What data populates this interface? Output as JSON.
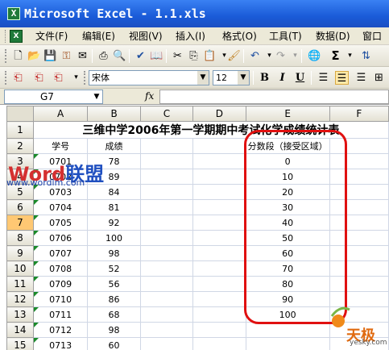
{
  "window": {
    "title": "Microsoft Excel - 1.1.xls",
    "app_icon_letter": "X"
  },
  "menu": [
    "文件(F)",
    "编辑(E)",
    "视图(V)",
    "插入(I)",
    "格式(O)",
    "工具(T)",
    "数据(D)",
    "窗口"
  ],
  "toolbar": {
    "font_name": "宋体",
    "font_size": "12",
    "bold": "B",
    "italic": "I",
    "underline": "U",
    "sigma": "Σ"
  },
  "formula_bar": {
    "name_box": "G7",
    "fx_label": "fx",
    "formula": ""
  },
  "sheet": {
    "columns": [
      "A",
      "B",
      "C",
      "D",
      "E",
      "F"
    ],
    "rows": [
      {
        "num": "1",
        "a": "",
        "b": "",
        "e": ""
      },
      {
        "num": "2",
        "a": "学号",
        "b": "成绩",
        "e": "分数段（接受区域）"
      },
      {
        "num": "3",
        "a": "0701",
        "b": "78",
        "e": "0"
      },
      {
        "num": "4",
        "a": "0702",
        "b": "89",
        "e": "10"
      },
      {
        "num": "5",
        "a": "0703",
        "b": "84",
        "e": "20"
      },
      {
        "num": "6",
        "a": "0704",
        "b": "81",
        "e": "30"
      },
      {
        "num": "7",
        "a": "0705",
        "b": "92",
        "e": "40"
      },
      {
        "num": "8",
        "a": "0706",
        "b": "100",
        "e": "50"
      },
      {
        "num": "9",
        "a": "0707",
        "b": "98",
        "e": "60"
      },
      {
        "num": "10",
        "a": "0708",
        "b": "52",
        "e": "70"
      },
      {
        "num": "11",
        "a": "0709",
        "b": "56",
        "e": "80"
      },
      {
        "num": "12",
        "a": "0710",
        "b": "86",
        "e": "90"
      },
      {
        "num": "13",
        "a": "0711",
        "b": "68",
        "e": "100"
      },
      {
        "num": "14",
        "a": "0712",
        "b": "98",
        "e": ""
      },
      {
        "num": "15",
        "a": "0713",
        "b": "60",
        "e": ""
      }
    ],
    "title": "三维中学2006年第一学期期中考试化学成绩统计表",
    "selected_cell": "G7",
    "highlight_color": "#e01010"
  },
  "watermarks": {
    "left_brand_a": "Word",
    "left_brand_b": "联盟",
    "left_url": "www.wordlm.com",
    "right_brand": "天极",
    "right_url": "yesky.com"
  }
}
